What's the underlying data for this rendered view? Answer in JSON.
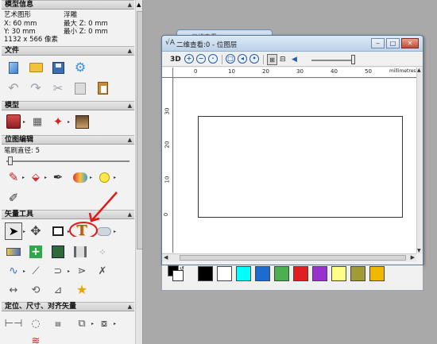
{
  "left_panel": {
    "sections": {
      "model_info": "模型信息",
      "file": "文件",
      "model": "模型",
      "bitmap_edit": "位图编辑",
      "vector_tools": "矢量工具",
      "position": "定位、尺寸、对齐矢量"
    },
    "model_info": {
      "art_model": "艺术图形",
      "width": "X: 60 mm",
      "height": "Y: 30 mm",
      "pixels": "1132 x 566 像素",
      "relief": "浮雕",
      "max_z": "最大 Z: 0 mm",
      "min_z": "最小 Z: 0 mm"
    },
    "bitmap_edit": {
      "brush_diameter_label": "笔刷直径: 5",
      "brush_diameter_value": 5
    }
  },
  "bg_window": {
    "title": "三维查看"
  },
  "window": {
    "title": "二维查看:0 - 位图层",
    "toolbar": {
      "three_d_label": "3D"
    },
    "ruler_h": {
      "labels": [
        "0",
        "10",
        "20",
        "30",
        "40",
        "50"
      ],
      "unit": "millimetres"
    },
    "ruler_v": {
      "labels": [
        "30",
        "20",
        "10",
        "0"
      ]
    }
  },
  "palette": {
    "foreground": "#000000",
    "background": "#ffffff",
    "colors": [
      "#000000",
      "#ffffff",
      "#00ffff",
      "#1e6bd0",
      "#4caf50",
      "#e02020",
      "#9b30d0",
      "#ffff88",
      "#a09a38",
      "#f0b800"
    ]
  },
  "annotation": {
    "arrow_color": "#e01818",
    "circle_color": "#e01818"
  }
}
